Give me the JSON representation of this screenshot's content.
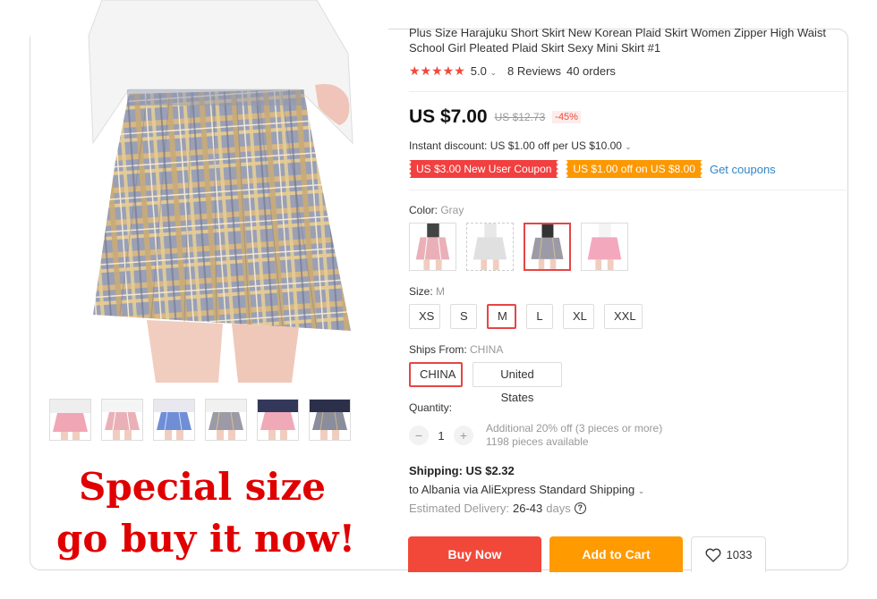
{
  "product": {
    "title": "Plus Size Harajuku Short Skirt New Korean Plaid Skirt Women Zipper High Waist School Girl Pleated Plaid Skirt Sexy Mini Skirt #1",
    "rating": "5.0",
    "stars": "★★★★★",
    "reviews": "8 Reviews",
    "orders": "40 orders"
  },
  "promo": {
    "line1": "Special size",
    "line2": "go buy it now!"
  },
  "price": {
    "current": "US $7.00",
    "original": "US $12.73",
    "discount": "-45%",
    "instant_discount": "Instant discount: US $1.00 off per US $10.00"
  },
  "coupons": {
    "new_user": "US $3.00 New User Coupon",
    "store": "US $1.00 off on US $8.00",
    "get_label": "Get coupons"
  },
  "color": {
    "label": "Color: ",
    "selected": "Gray",
    "swatches": [
      "pink-plaid",
      "white",
      "gray-plaid",
      "pink"
    ]
  },
  "size": {
    "label": "Size: ",
    "selected": "M",
    "options": [
      "XS",
      "S",
      "M",
      "L",
      "XL",
      "XXL"
    ]
  },
  "ships_from": {
    "label": "Ships From: ",
    "selected": "CHINA",
    "options": [
      "CHINA",
      "United States"
    ]
  },
  "quantity": {
    "label": "Quantity:",
    "minus": "−",
    "plus": "+",
    "value": "1",
    "note1": "Additional 20% off (3 pieces or more)",
    "note2": "1198 pieces available"
  },
  "shipping": {
    "cost": "Shipping: US $2.32",
    "route": "to Albania via AliExpress Standard Shipping",
    "delivery_label": "Estimated Delivery:",
    "delivery_days": "26-43",
    "delivery_unit": "days"
  },
  "actions": {
    "buy_now": "Buy Now",
    "add_to_cart": "Add to Cart",
    "wishlist_count": "1033"
  },
  "colors": {
    "accent_red": "#f2483a",
    "accent_orange": "#ff9a00",
    "link_blue": "#2f86c7",
    "promo_red": "#e00000"
  }
}
